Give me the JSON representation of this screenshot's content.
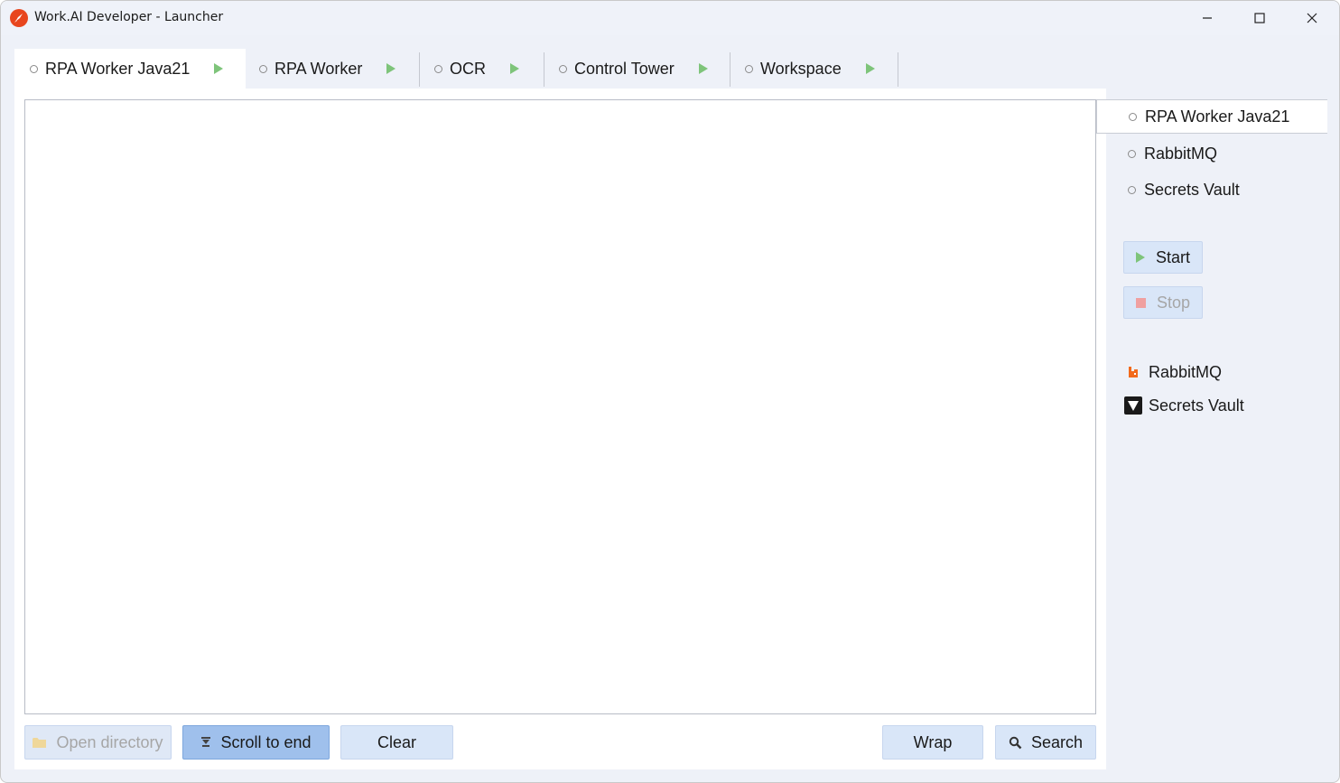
{
  "window": {
    "title": "Work.AI Developer - Launcher",
    "controls": {
      "minimize": "minimize",
      "maximize": "maximize",
      "close": "close"
    }
  },
  "tabs": [
    {
      "label": "RPA Worker Java21",
      "active": true
    },
    {
      "label": "RPA Worker",
      "active": false
    },
    {
      "label": "OCR",
      "active": false
    },
    {
      "label": "Control Tower",
      "active": false
    },
    {
      "label": "Workspace",
      "active": false
    }
  ],
  "toolbar": {
    "open_directory": "Open directory",
    "scroll_to_end": "Scroll to end",
    "clear": "Clear",
    "wrap": "Wrap",
    "search": "Search"
  },
  "sidebar": {
    "services": [
      {
        "label": "RPA Worker Java21",
        "selected": true
      },
      {
        "label": "RabbitMQ",
        "selected": false
      },
      {
        "label": "Secrets Vault",
        "selected": false
      }
    ],
    "start": "Start",
    "stop": "Stop",
    "links": [
      {
        "label": "RabbitMQ",
        "icon": "rabbitmq-icon"
      },
      {
        "label": "Secrets Vault",
        "icon": "vault-icon"
      }
    ]
  },
  "colors": {
    "accent": "#d9e6f8",
    "pressed": "#9fc0ec",
    "play": "#7ec47a",
    "stop": "#f0a0a0",
    "app_icon": "#e8461e"
  }
}
